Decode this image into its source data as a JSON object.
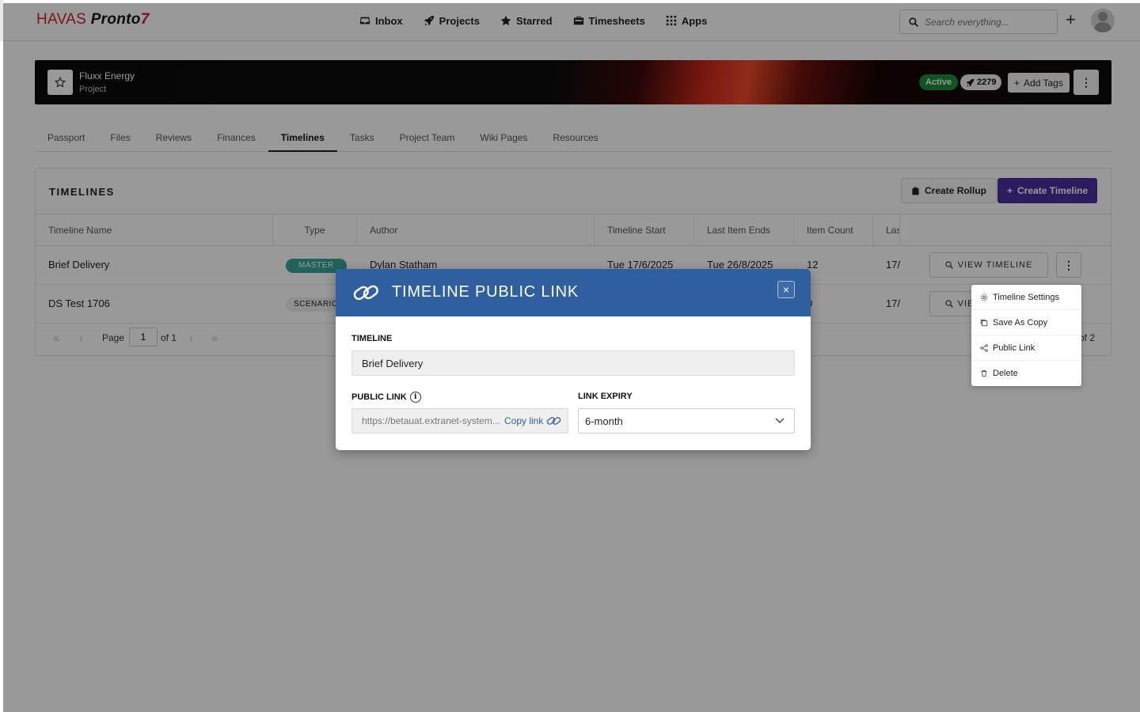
{
  "nav": {
    "brand_havas": "HAVAS",
    "brand_pronto": "Pronto",
    "brand_bolt": "7",
    "links": [
      {
        "label": "Inbox",
        "icon": "inbox-icon"
      },
      {
        "label": "Projects",
        "icon": "rocket-icon"
      },
      {
        "label": "Starred",
        "icon": "star-icon"
      },
      {
        "label": "Timesheets",
        "icon": "timesheet-icon"
      },
      {
        "label": "Apps",
        "icon": "grid-icon"
      }
    ],
    "search_placeholder": "Search everything...",
    "plus_label": "+"
  },
  "project": {
    "name": "Fluxx Energy",
    "type": "Project",
    "status": "Active",
    "count": "2279",
    "add_tags": "Add Tags"
  },
  "tabs": [
    "Passport",
    "Files",
    "Reviews",
    "Finances",
    "Timelines",
    "Tasks",
    "Project Team",
    "Wiki Pages",
    "Resources"
  ],
  "active_tab": "Timelines",
  "timelines": {
    "title": "TIMELINES",
    "create_rollup": "Create Rollup",
    "create_timeline": "Create Timeline",
    "columns": [
      "Timeline Name",
      "Type",
      "Author",
      "Timeline Start",
      "Last Item Ends",
      "Item Count",
      "Las"
    ],
    "rows": [
      {
        "name": "Brief Delivery",
        "type": "MASTER",
        "author": "Dylan Statham",
        "start": "Tue 17/6/2025",
        "end": "Tue 26/8/2025",
        "count": "12",
        "last": "17/",
        "view": "VIEW TIMELINE"
      },
      {
        "name": "DS Test 1706",
        "type": "SCENARIO",
        "author": "",
        "start": "",
        "end": "",
        "count": "0",
        "last": "17/",
        "view": "VIEW TIMELINE"
      }
    ],
    "pager": {
      "page_label": "Page",
      "page_value": "1",
      "of_label": "of 1",
      "right_text": "of 2"
    }
  },
  "row_menu": {
    "items": [
      {
        "label": "Timeline Settings",
        "icon": "gear-icon"
      },
      {
        "label": "Save As Copy",
        "icon": "copy-icon"
      },
      {
        "label": "Public Link",
        "icon": "share-icon"
      },
      {
        "label": "Delete",
        "icon": "trash-icon"
      }
    ]
  },
  "modal": {
    "title": "TIMELINE PUBLIC LINK",
    "timeline_label": "TIMELINE",
    "timeline_value": "Brief Delivery",
    "public_link_label": "PUBLIC LINK",
    "public_link_url": "https://betauat.extranet-system...",
    "copy_link": "Copy link",
    "expiry_label": "LINK EXPIRY",
    "expiry_value": "6-month"
  },
  "colors": {
    "accent": "#4c2d9e",
    "modal_header": "#2f5f9e",
    "active_badge": "#1f8a3a",
    "master_tag": "#3aa39a",
    "brand_red": "#d21f2b"
  }
}
